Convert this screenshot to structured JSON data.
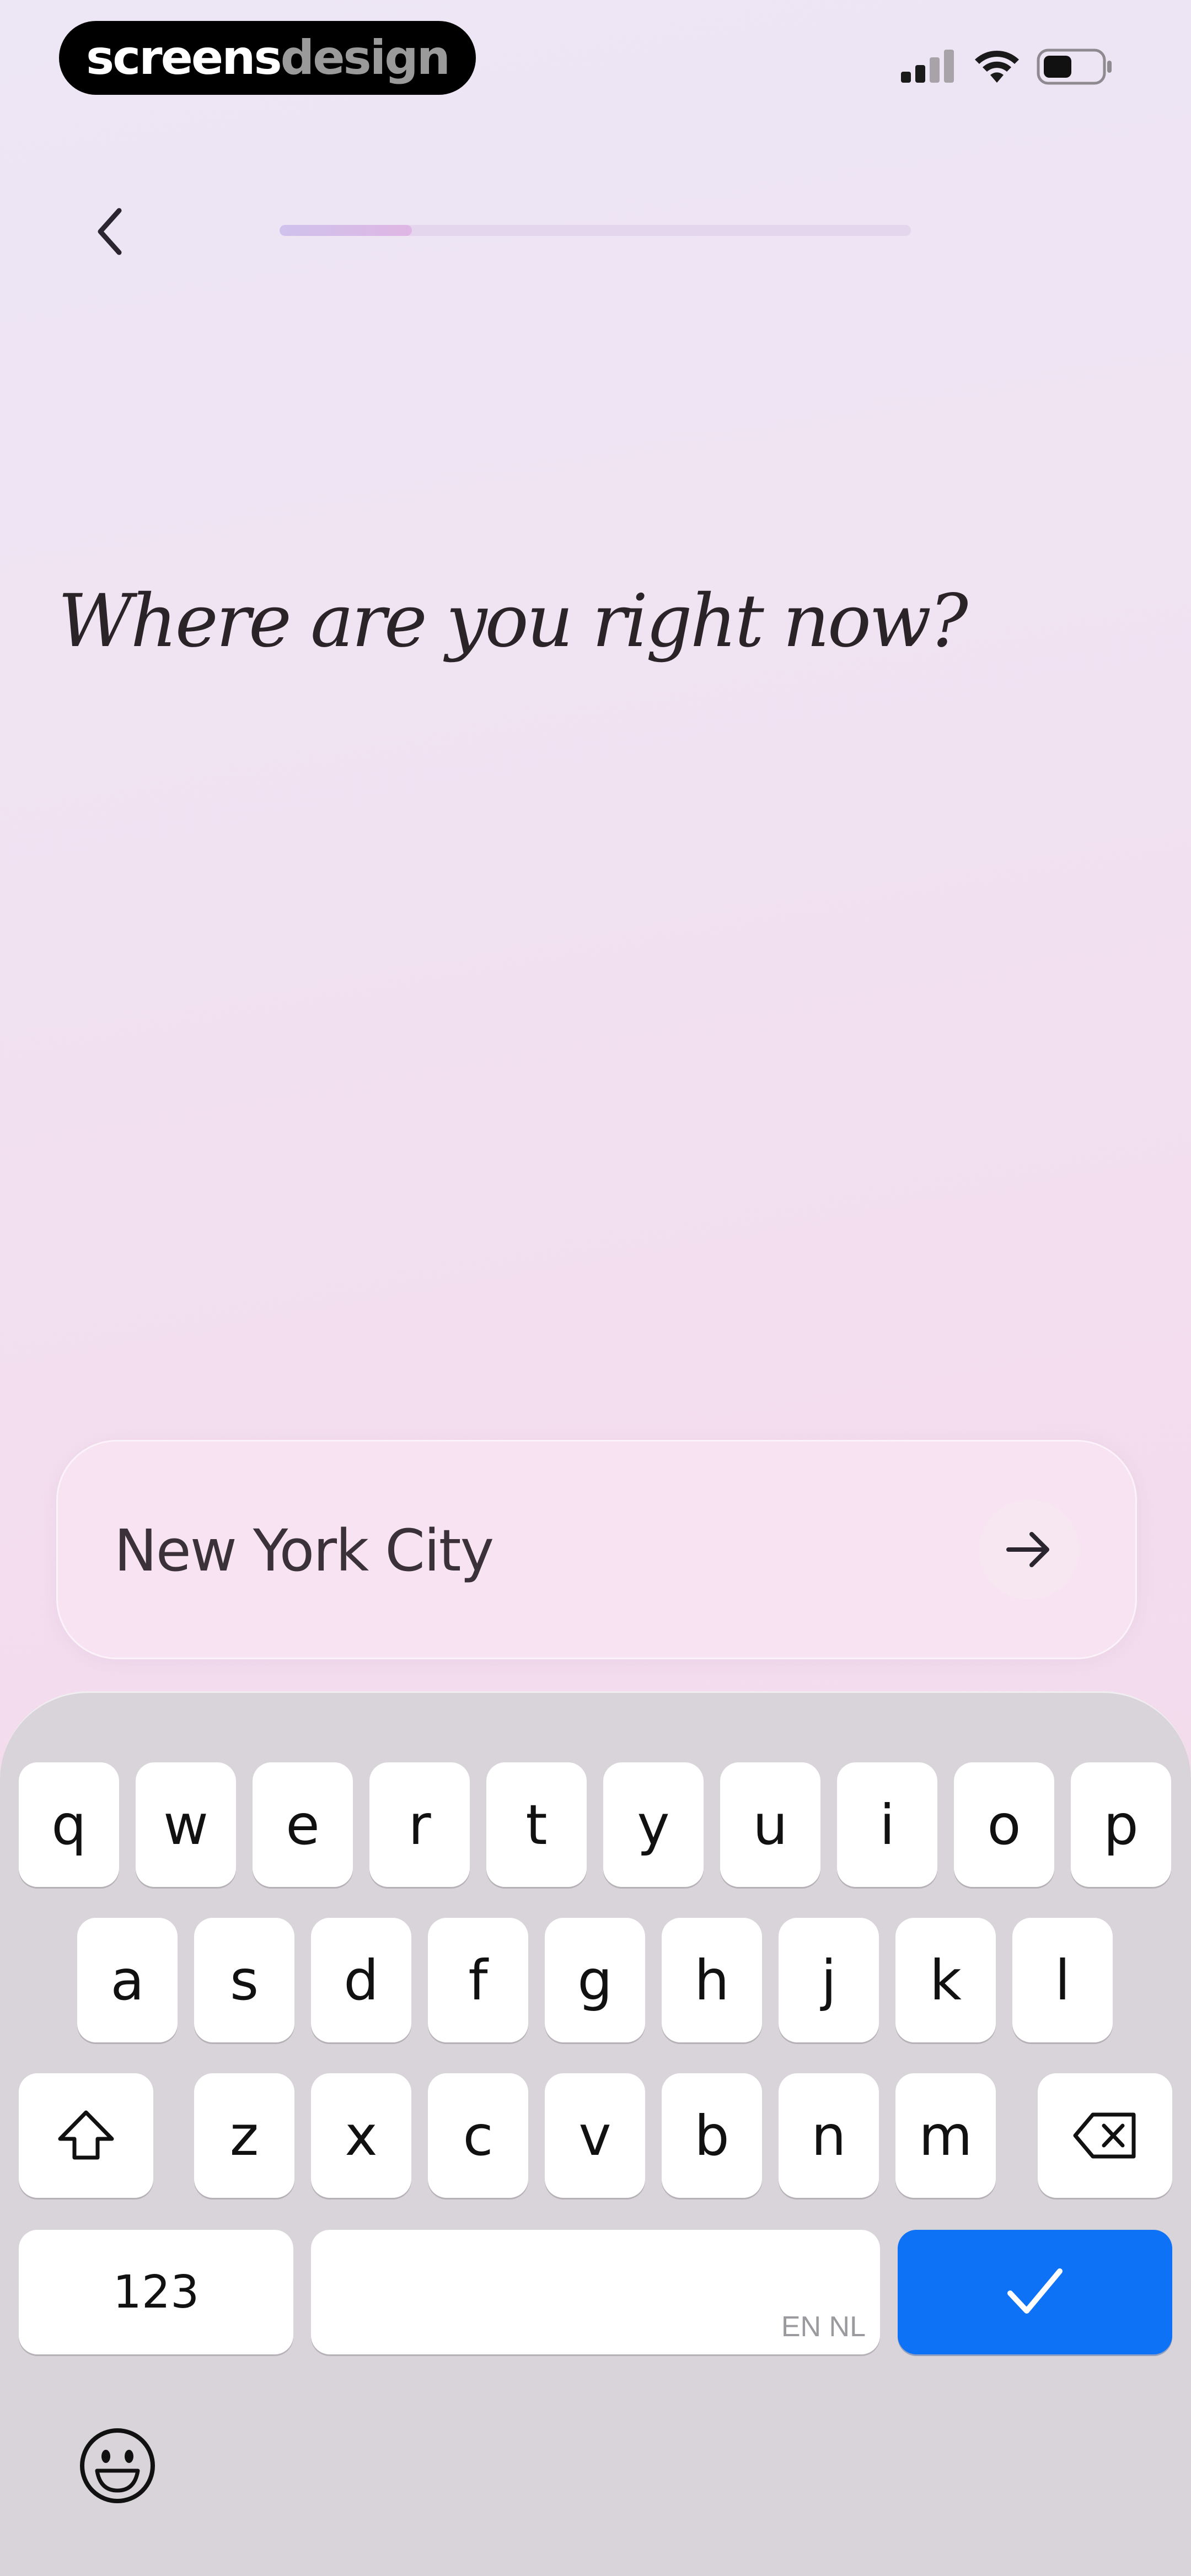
{
  "watermark": {
    "bold_text": "screens",
    "light_text": "design"
  },
  "status_bar": {
    "signal_icon": "cellular-signal-icon",
    "wifi_icon": "wifi-icon",
    "battery_icon": "battery-icon",
    "battery_level": 0.5
  },
  "nav": {
    "back_icon": "chevron-left-icon",
    "progress": 0.21
  },
  "question": {
    "text": "Where are you right now?"
  },
  "location_input": {
    "value": "New York City",
    "submit_icon": "arrow-right-icon"
  },
  "keyboard": {
    "row1": [
      "q",
      "w",
      "e",
      "r",
      "t",
      "y",
      "u",
      "i",
      "o",
      "p"
    ],
    "row2": [
      "a",
      "s",
      "d",
      "f",
      "g",
      "h",
      "j",
      "k",
      "l"
    ],
    "row3": [
      "z",
      "x",
      "c",
      "v",
      "b",
      "n",
      "m"
    ],
    "shift_icon": "shift-icon",
    "delete_icon": "backspace-icon",
    "numbers_label": "123",
    "space_language_label": "EN NL",
    "done_icon": "checkmark-icon",
    "emoji_icon": "emoji-icon",
    "done_color": "#0d72f5"
  },
  "colors": {
    "text_primary": "#2a2328",
    "accent_blue": "#0d72f5"
  }
}
